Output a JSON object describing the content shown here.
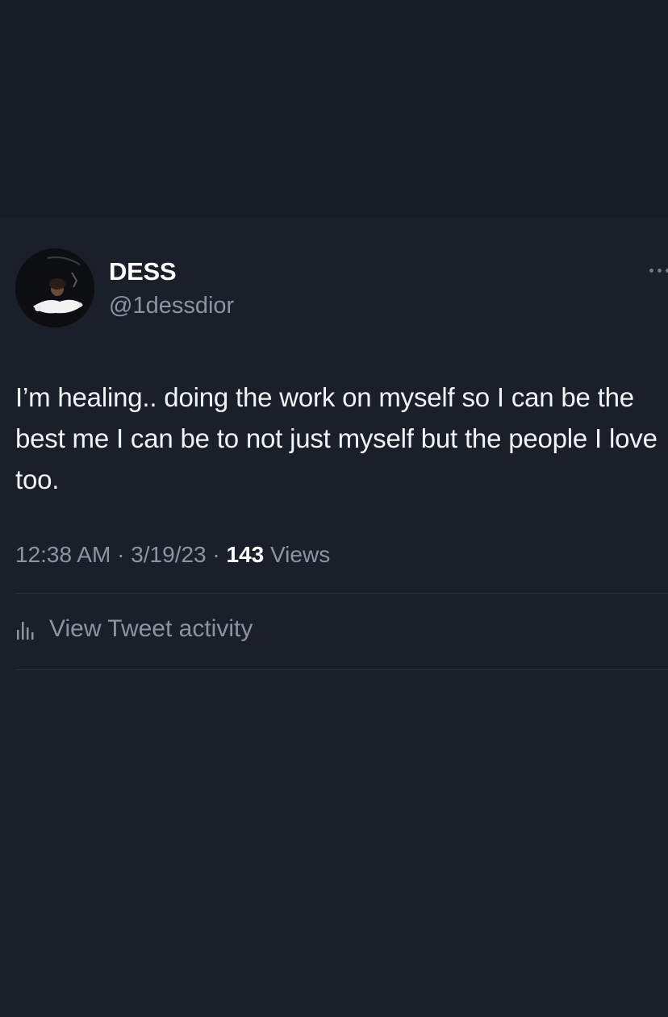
{
  "tweet": {
    "display_name": "DESS",
    "handle": "@1dessdior",
    "text": "I’m healing.. doing the work on myself so I can be the best me I can be to not just myself but the people I love too.",
    "time": "12:38 AM",
    "date": "3/19/23",
    "separator": "·",
    "views_count": "143",
    "views_label": "Views",
    "activity_label": "View Tweet activity"
  },
  "icons": {
    "more": "more-dots-icon",
    "activity": "bar-chart-icon"
  },
  "colors": {
    "background": "#1a1f2a",
    "primary_text": "#ffffff",
    "secondary_text": "#8b95a1",
    "divider": "#2d333d"
  }
}
